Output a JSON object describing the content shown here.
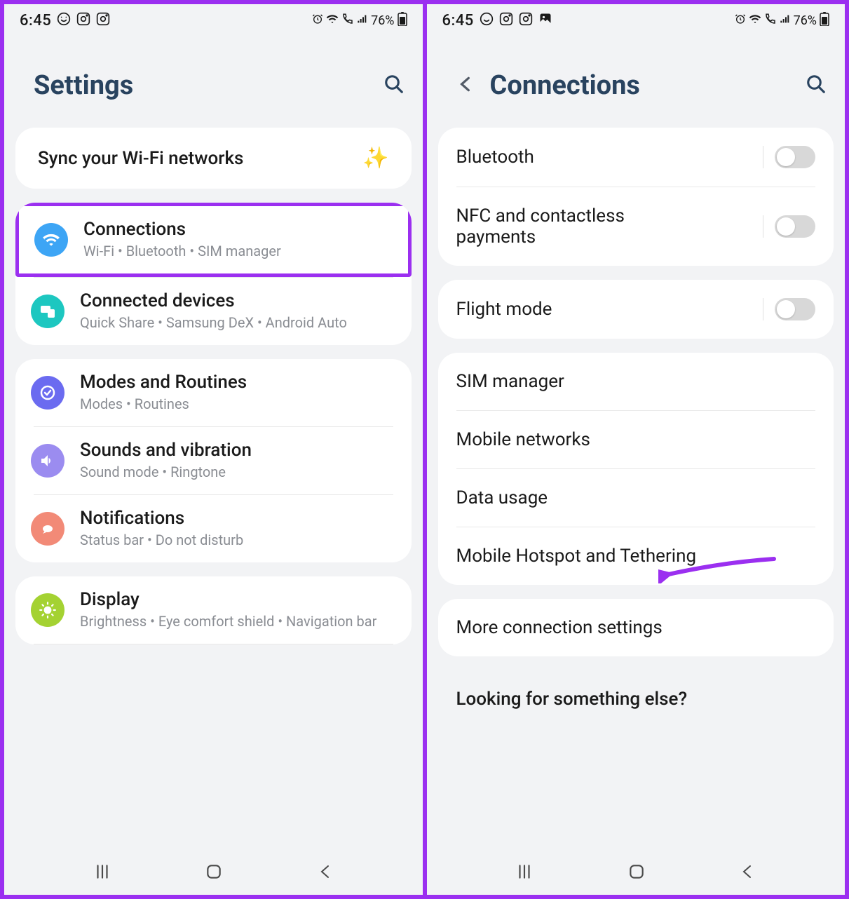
{
  "status": {
    "time": "6:45",
    "battery": "76%"
  },
  "left": {
    "title": "Settings",
    "promo": "Sync your Wi-Fi networks",
    "groups": [
      {
        "items": [
          {
            "title": "Connections",
            "sub": "Wi-Fi  •  Bluetooth  •  SIM manager",
            "color": "bg-blue",
            "highlight": true
          },
          {
            "title": "Connected devices",
            "sub": "Quick Share  •  Samsung DeX  •  Android Auto",
            "color": "bg-teal"
          }
        ]
      },
      {
        "items": [
          {
            "title": "Modes and Routines",
            "sub": "Modes  •  Routines",
            "color": "bg-purple"
          },
          {
            "title": "Sounds and vibration",
            "sub": "Sound mode  •  Ringtone",
            "color": "bg-lilac"
          },
          {
            "title": "Notifications",
            "sub": "Status bar  •  Do not disturb",
            "color": "bg-coral"
          }
        ]
      },
      {
        "items": [
          {
            "title": "Display",
            "sub": "Brightness  •  Eye comfort shield  •  Navigation bar",
            "color": "bg-lime"
          }
        ]
      }
    ]
  },
  "right": {
    "title": "Connections",
    "groups": [
      {
        "rows": [
          {
            "label": "Bluetooth",
            "toggle": true
          },
          {
            "label": "NFC and contactless payments",
            "toggle": true
          }
        ]
      },
      {
        "rows": [
          {
            "label": "Flight mode",
            "toggle": true
          }
        ]
      },
      {
        "rows": [
          {
            "label": "SIM manager"
          },
          {
            "label": "Mobile networks",
            "arrow": true
          },
          {
            "label": "Data usage"
          },
          {
            "label": "Mobile Hotspot and Tethering"
          }
        ]
      },
      {
        "rows": [
          {
            "label": "More connection settings"
          }
        ]
      }
    ],
    "footer": "Looking for something else?"
  }
}
